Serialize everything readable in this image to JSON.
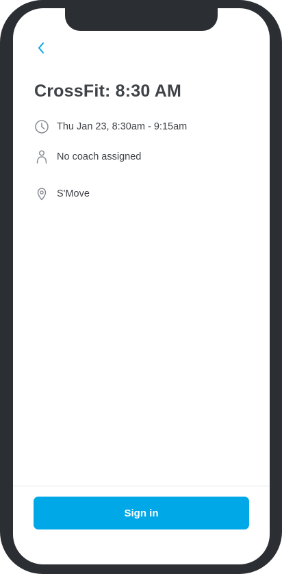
{
  "colors": {
    "accent": "#00a8e8",
    "text": "#3f4247",
    "icon": "#8a8d93",
    "frame": "#2b2e33"
  },
  "header": {
    "back_icon": "chevron-left-icon"
  },
  "event": {
    "title": "CrossFit: 8:30 AM",
    "time": {
      "icon": "clock-icon",
      "text": "Thu Jan 23, 8:30am - 9:15am"
    },
    "coach": {
      "icon": "person-icon",
      "text": "No coach assigned"
    },
    "location": {
      "icon": "map-pin-icon",
      "text": "S'Move"
    }
  },
  "footer": {
    "sign_in_label": "Sign in"
  }
}
